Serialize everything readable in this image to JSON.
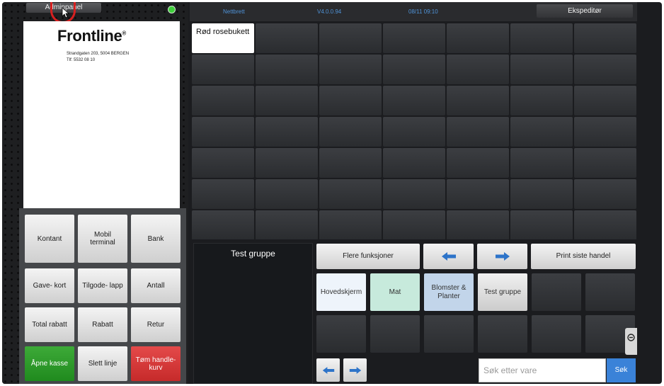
{
  "header": {
    "admin_label": "Adminpanel",
    "left_info": "Nettbrett",
    "version": "V4.0.0.94",
    "datetime": "08/11 09:10",
    "user_button": "Ekspeditør"
  },
  "receipt": {
    "logo": "Frontline",
    "logo_mark": "®",
    "address": "Strandgaten 203, 5004 BERGEN",
    "phone": "Tlf: 5532 08 10"
  },
  "payment_buttons": {
    "kontant": "Kontant",
    "mobil": "Mobil terminal",
    "bank": "Bank",
    "gavekort": "Gave- kort",
    "tilgode": "Tilgode- lapp",
    "antall": "Antall",
    "total_rabatt": "Total rabatt",
    "rabatt": "Rabatt",
    "retur": "Retur",
    "apne_kasse": "Åpne kasse",
    "slett_linje": "Slett linje",
    "tom_handlekurv": "Tøm handle- kurv"
  },
  "products": {
    "first": "Rød rosebukett"
  },
  "group_panel": {
    "title": "Test gruppe"
  },
  "function_buttons": {
    "more": "Flere funksjoner",
    "print_last": "Print siste handel"
  },
  "groups": {
    "hovedskjerm": "Hovedskjerm",
    "mat": "Mat",
    "blomster": "Blomster & Planter",
    "test_gruppe": "Test gruppe"
  },
  "search": {
    "placeholder": "Søk etter vare",
    "button": "Søk"
  },
  "colors": {
    "accent_blue": "#3a82d8",
    "green": "#2e9c2a",
    "red": "#d63838",
    "mat_bg": "#c7eadc",
    "blomster_bg": "#c2d5ea",
    "hovedskjerm_bg": "#eef4fb"
  }
}
